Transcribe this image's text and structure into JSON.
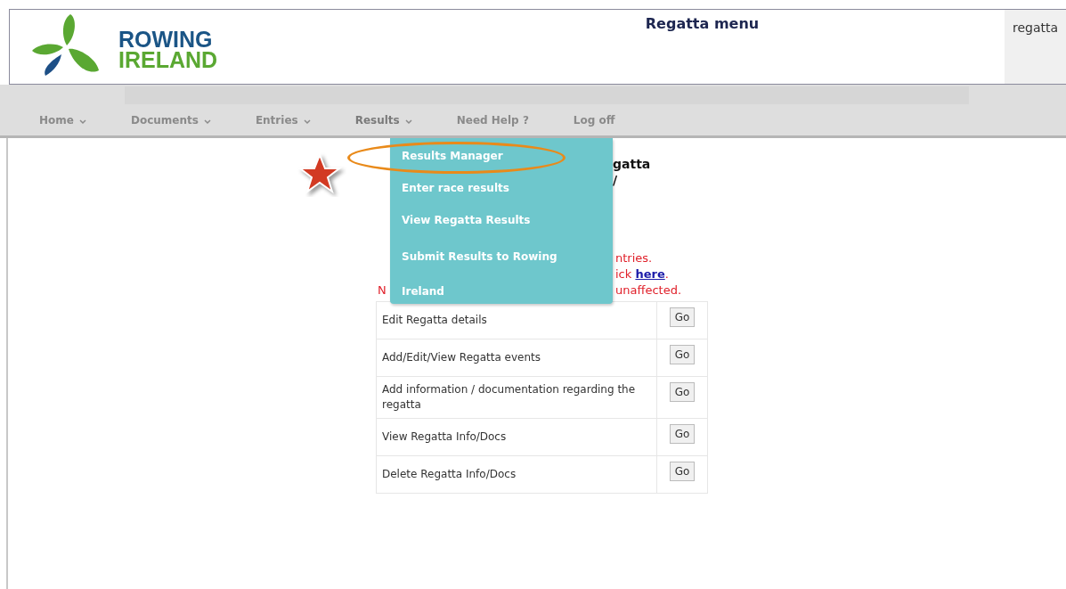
{
  "header": {
    "logo": {
      "line_1": "ROWING",
      "line_2": "IRELAND"
    },
    "title": "Regatta menu",
    "side_panel": "regatta"
  },
  "nav": {
    "items": [
      {
        "label": "Home",
        "caret": true,
        "open": false
      },
      {
        "label": "Documents",
        "caret": true,
        "open": false
      },
      {
        "label": "Entries",
        "caret": true,
        "open": false
      },
      {
        "label": "Results",
        "caret": true,
        "open": true
      },
      {
        "label": "Need Help ?",
        "caret": false,
        "open": false
      },
      {
        "label": "Log off",
        "caret": false,
        "open": false
      }
    ]
  },
  "dropdown": {
    "items": [
      {
        "label": "Results Manager",
        "circled": true
      },
      {
        "label": "Enter race results",
        "circled": false
      },
      {
        "label": "View Regatta Results",
        "circled": false
      },
      {
        "label": "Submit Results to Rowing Ireland",
        "circled": false
      }
    ]
  },
  "annotation": {
    "star": true
  },
  "content": {
    "heading_fragments": [
      "gatta",
      "/"
    ],
    "notice_fragments": [
      {
        "right": "ntries."
      },
      {
        "right": "ick **here**."
      },
      {
        "left": "N",
        "right": "unaffected."
      }
    ],
    "rows": [
      {
        "label": "Edit Regatta details",
        "button": "Go"
      },
      {
        "label": "Add/Edit/View Regatta events",
        "button": "Go"
      },
      {
        "label": "Add information / documentation regarding the regatta",
        "button": "Go"
      },
      {
        "label": "View Regatta Info/Docs",
        "button": "Go"
      },
      {
        "label": "Delete Regatta Info/Docs",
        "button": "Go"
      }
    ]
  }
}
